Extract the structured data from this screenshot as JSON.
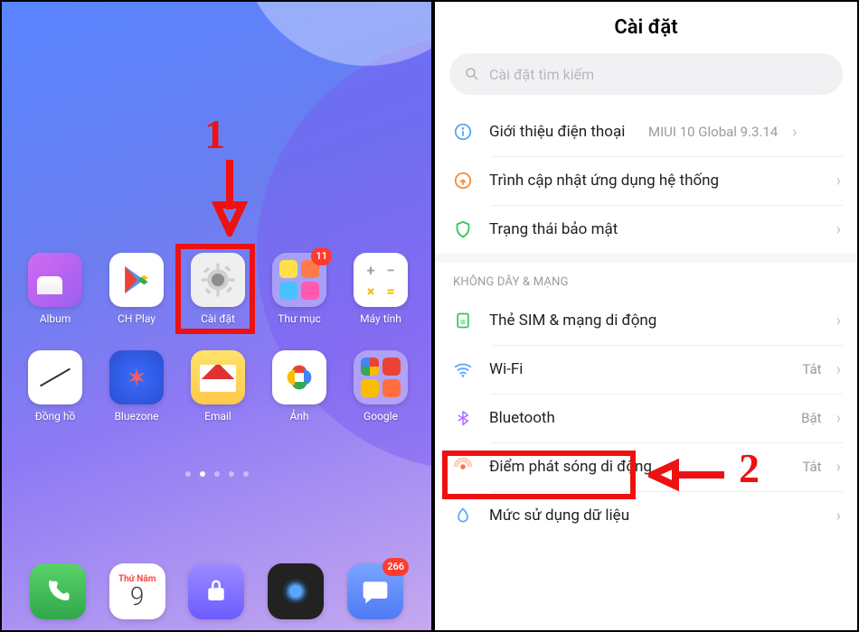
{
  "annotations": {
    "step1": "1",
    "step2": "2"
  },
  "home": {
    "apps": [
      {
        "key": "album",
        "label": "Album"
      },
      {
        "key": "chplay",
        "label": "CH Play"
      },
      {
        "key": "settings",
        "label": "Cài đặt"
      },
      {
        "key": "folder1",
        "label": "Thư mục",
        "badge": "11"
      },
      {
        "key": "calc",
        "label": "Máy tính"
      },
      {
        "key": "clock",
        "label": "Đồng hồ"
      },
      {
        "key": "bluezone",
        "label": "Bluezone"
      },
      {
        "key": "email",
        "label": "Email"
      },
      {
        "key": "photos",
        "label": "Ảnh"
      },
      {
        "key": "google",
        "label": "Google"
      }
    ],
    "dock": {
      "calendar": {
        "dow": "Thứ Năm",
        "day": "9"
      },
      "messages_badge": "266"
    }
  },
  "settings": {
    "title": "Cài đặt",
    "search_placeholder": "Cài đặt tìm kiếm",
    "rows": {
      "about": {
        "label": "Giới thiệu điện thoại",
        "value": "MIUI 10 Global 9.3.14"
      },
      "updater": {
        "label": "Trình cập nhật ứng dụng hệ thống"
      },
      "security": {
        "label": "Trạng thái bảo mật"
      }
    },
    "section_wireless": "KHÔNG DÂY & MẠNG",
    "wireless": {
      "sim": {
        "label": "Thẻ SIM & mạng di động"
      },
      "wifi": {
        "label": "Wi-Fi",
        "value": "Tắt"
      },
      "bluetooth": {
        "label": "Bluetooth",
        "value": "Bật"
      },
      "hotspot": {
        "label": "Điểm phát sóng di động",
        "value": "Tắt"
      },
      "data": {
        "label": "Mức sử dụng dữ liệu"
      }
    }
  }
}
